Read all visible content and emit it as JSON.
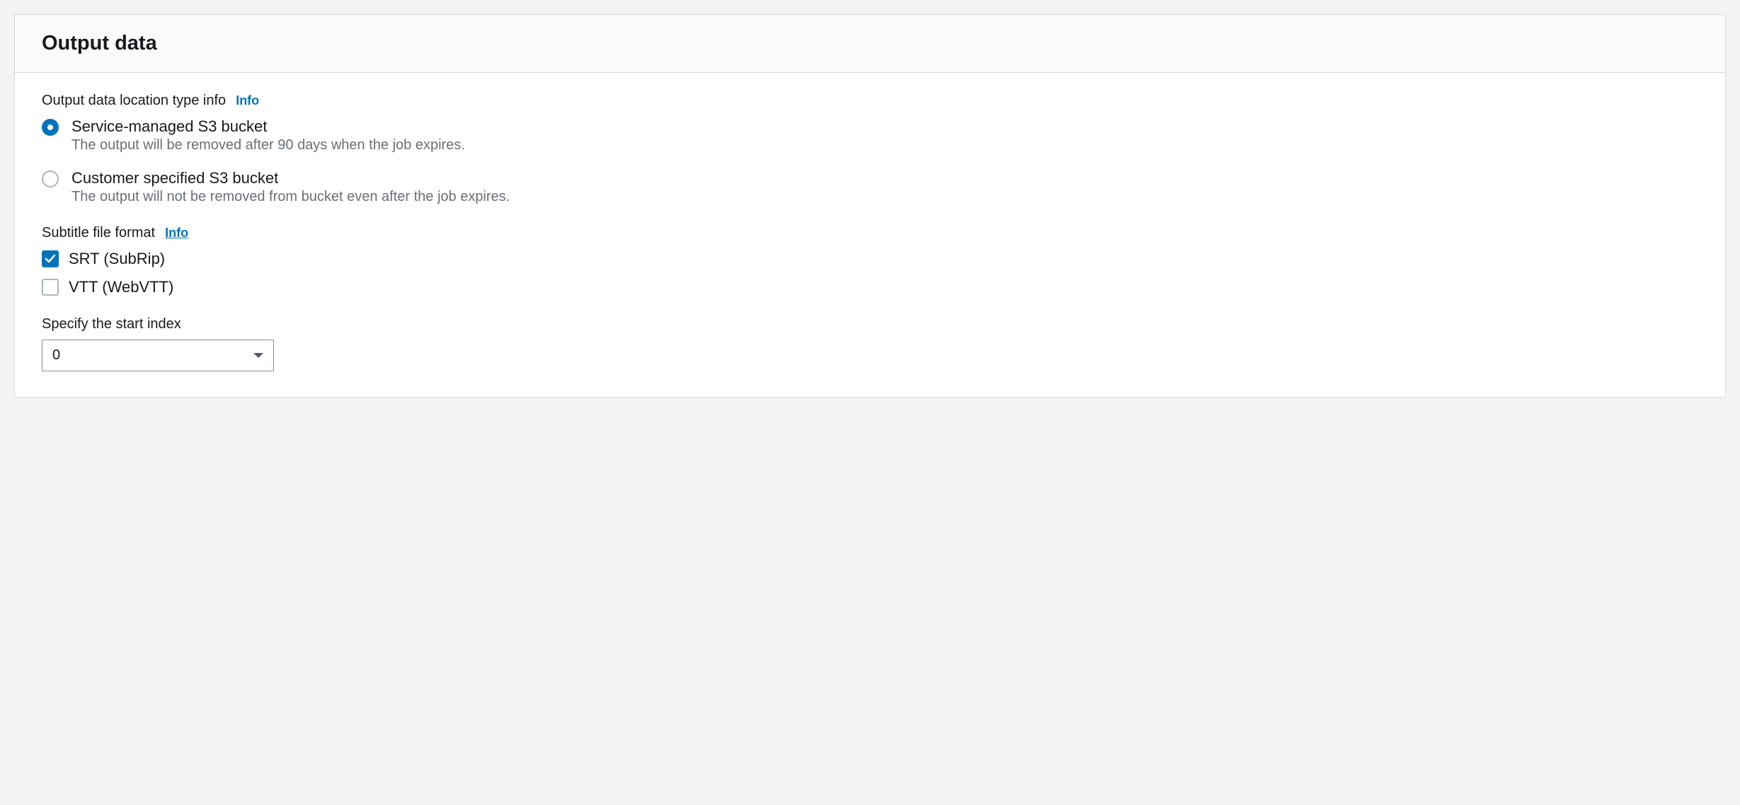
{
  "panel": {
    "title": "Output data"
  },
  "locationType": {
    "label": "Output data location type info",
    "infoLabel": "Info",
    "options": [
      {
        "title": "Service-managed S3 bucket",
        "description": "The output will be removed after 90 days when the job expires.",
        "selected": true
      },
      {
        "title": "Customer specified S3 bucket",
        "description": "The output will not be removed from bucket even after the job expires.",
        "selected": false
      }
    ]
  },
  "subtitleFormat": {
    "label": "Subtitle file format",
    "infoLabel": "Info",
    "options": [
      {
        "label": "SRT (SubRip)",
        "checked": true
      },
      {
        "label": "VTT (WebVTT)",
        "checked": false
      }
    ]
  },
  "startIndex": {
    "label": "Specify the start index",
    "value": "0"
  }
}
